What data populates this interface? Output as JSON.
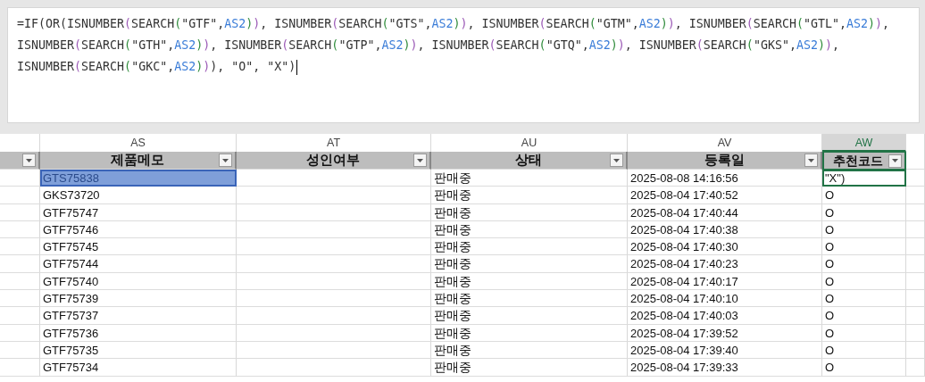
{
  "formula_bar": {
    "lines": [
      [
        {
          "kind": "text",
          "t": "=IF(OR(ISNUMBER"
        },
        {
          "kind": "paren1",
          "t": "("
        },
        {
          "kind": "text",
          "t": "SEARCH"
        },
        {
          "kind": "paren2",
          "t": "("
        },
        {
          "kind": "text",
          "t": "\"GTF\","
        },
        {
          "kind": "ref",
          "t": "AS2"
        },
        {
          "kind": "paren2",
          "t": ")"
        },
        {
          "kind": "paren1",
          "t": ")"
        },
        {
          "kind": "text",
          "t": ", ISNUMBER"
        },
        {
          "kind": "paren1",
          "t": "("
        },
        {
          "kind": "text",
          "t": "SEARCH"
        },
        {
          "kind": "paren2",
          "t": "("
        },
        {
          "kind": "text",
          "t": "\"GTS\","
        },
        {
          "kind": "ref",
          "t": "AS2"
        },
        {
          "kind": "paren2",
          "t": ")"
        },
        {
          "kind": "paren1",
          "t": ")"
        },
        {
          "kind": "text",
          "t": ", ISNUMBER"
        },
        {
          "kind": "paren1",
          "t": "("
        },
        {
          "kind": "text",
          "t": "SEARCH"
        },
        {
          "kind": "paren2",
          "t": "("
        },
        {
          "kind": "text",
          "t": "\"GTM\","
        },
        {
          "kind": "ref",
          "t": "AS2"
        },
        {
          "kind": "paren2",
          "t": ")"
        },
        {
          "kind": "paren1",
          "t": ")"
        },
        {
          "kind": "text",
          "t": ", ISNUMBER"
        },
        {
          "kind": "paren1",
          "t": "("
        },
        {
          "kind": "text",
          "t": "SEARCH"
        },
        {
          "kind": "paren2",
          "t": "("
        },
        {
          "kind": "text",
          "t": "\"GTL\","
        },
        {
          "kind": "ref",
          "t": "AS2"
        },
        {
          "kind": "paren2",
          "t": ")"
        },
        {
          "kind": "paren1",
          "t": ")"
        },
        {
          "kind": "text",
          "t": ","
        }
      ],
      [
        {
          "kind": "text",
          "t": "ISNUMBER"
        },
        {
          "kind": "paren1",
          "t": "("
        },
        {
          "kind": "text",
          "t": "SEARCH"
        },
        {
          "kind": "paren2",
          "t": "("
        },
        {
          "kind": "text",
          "t": "\"GTH\","
        },
        {
          "kind": "ref",
          "t": "AS2"
        },
        {
          "kind": "paren2",
          "t": ")"
        },
        {
          "kind": "paren1",
          "t": ")"
        },
        {
          "kind": "text",
          "t": ", ISNUMBER"
        },
        {
          "kind": "paren1",
          "t": "("
        },
        {
          "kind": "text",
          "t": "SEARCH"
        },
        {
          "kind": "paren2",
          "t": "("
        },
        {
          "kind": "text",
          "t": "\"GTP\","
        },
        {
          "kind": "ref",
          "t": "AS2"
        },
        {
          "kind": "paren2",
          "t": ")"
        },
        {
          "kind": "paren1",
          "t": ")"
        },
        {
          "kind": "text",
          "t": ", ISNUMBER"
        },
        {
          "kind": "paren1",
          "t": "("
        },
        {
          "kind": "text",
          "t": "SEARCH"
        },
        {
          "kind": "paren2",
          "t": "("
        },
        {
          "kind": "text",
          "t": "\"GTQ\","
        },
        {
          "kind": "ref",
          "t": "AS2"
        },
        {
          "kind": "paren2",
          "t": ")"
        },
        {
          "kind": "paren1",
          "t": ")"
        },
        {
          "kind": "text",
          "t": ", ISNUMBER"
        },
        {
          "kind": "paren1",
          "t": "("
        },
        {
          "kind": "text",
          "t": "SEARCH"
        },
        {
          "kind": "paren2",
          "t": "("
        },
        {
          "kind": "text",
          "t": "\"GKS\","
        },
        {
          "kind": "ref",
          "t": "AS2"
        },
        {
          "kind": "paren2",
          "t": ")"
        },
        {
          "kind": "paren1",
          "t": ")"
        },
        {
          "kind": "text",
          "t": ","
        }
      ],
      [
        {
          "kind": "text",
          "t": "ISNUMBER"
        },
        {
          "kind": "paren1",
          "t": "("
        },
        {
          "kind": "text",
          "t": "SEARCH"
        },
        {
          "kind": "paren2",
          "t": "("
        },
        {
          "kind": "text",
          "t": "\"GKC\","
        },
        {
          "kind": "ref",
          "t": "AS2"
        },
        {
          "kind": "paren2",
          "t": ")"
        },
        {
          "kind": "paren1",
          "t": ")"
        },
        {
          "kind": "text",
          "t": "), \"O\", \"X\")"
        }
      ]
    ]
  },
  "columns": [
    {
      "letter": "AS",
      "header": "제품메모",
      "active": false
    },
    {
      "letter": "AT",
      "header": "성인여부",
      "active": false
    },
    {
      "letter": "AU",
      "header": "상태",
      "active": false
    },
    {
      "letter": "AV",
      "header": "등록일",
      "active": false
    },
    {
      "letter": "AW",
      "header": "추천코드",
      "active": true
    }
  ],
  "rows": [
    {
      "memo": "GTS75838",
      "status": "판매중",
      "date": "2025-08-08 14:16:56",
      "code": "\"X\")",
      "memo_highlighted": true,
      "code_editing": true
    },
    {
      "memo": "GKS73720",
      "status": "판매중",
      "date": "2025-08-04 17:40:52",
      "code": "O",
      "memo_highlighted": false,
      "code_editing": false
    },
    {
      "memo": "GTF75747",
      "status": "판매중",
      "date": "2025-08-04 17:40:44",
      "code": "O",
      "memo_highlighted": false,
      "code_editing": false
    },
    {
      "memo": "GTF75746",
      "status": "판매중",
      "date": "2025-08-04 17:40:38",
      "code": "O",
      "memo_highlighted": false,
      "code_editing": false
    },
    {
      "memo": "GTF75745",
      "status": "판매중",
      "date": "2025-08-04 17:40:30",
      "code": "O",
      "memo_highlighted": false,
      "code_editing": false
    },
    {
      "memo": "GTF75744",
      "status": "판매중",
      "date": "2025-08-04 17:40:23",
      "code": "O",
      "memo_highlighted": false,
      "code_editing": false
    },
    {
      "memo": "GTF75740",
      "status": "판매중",
      "date": "2025-08-04 17:40:17",
      "code": "O",
      "memo_highlighted": false,
      "code_editing": false
    },
    {
      "memo": "GTF75739",
      "status": "판매중",
      "date": "2025-08-04 17:40:10",
      "code": "O",
      "memo_highlighted": false,
      "code_editing": false
    },
    {
      "memo": "GTF75737",
      "status": "판매중",
      "date": "2025-08-04 17:40:03",
      "code": "O",
      "memo_highlighted": false,
      "code_editing": false
    },
    {
      "memo": "GTF75736",
      "status": "판매중",
      "date": "2025-08-04 17:39:52",
      "code": "O",
      "memo_highlighted": false,
      "code_editing": false
    },
    {
      "memo": "GTF75735",
      "status": "판매중",
      "date": "2025-08-04 17:39:40",
      "code": "O",
      "memo_highlighted": false,
      "code_editing": false
    },
    {
      "memo": "GTF75734",
      "status": "판매중",
      "date": "2025-08-04 17:39:33",
      "code": "O",
      "memo_highlighted": false,
      "code_editing": false
    }
  ]
}
